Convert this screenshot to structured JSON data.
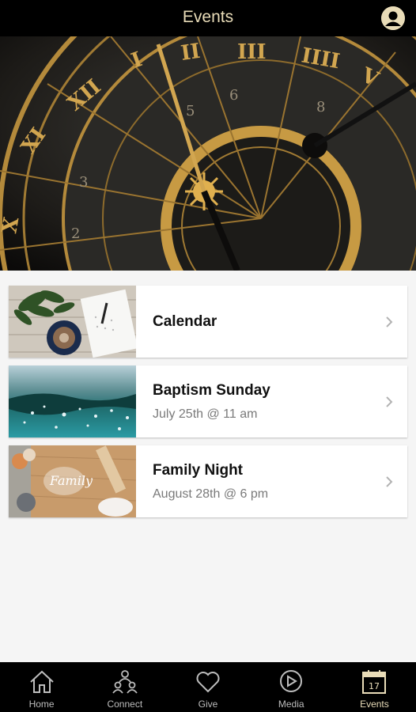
{
  "header": {
    "title": "Events",
    "profile_icon": "profile-icon"
  },
  "events": [
    {
      "name": "Calendar",
      "subtitle": "",
      "thumbnail": "notebook-coffee-photo",
      "chevron_icon": "chevron-right-icon"
    },
    {
      "name": "Baptism Sunday",
      "subtitle": "July 25th @ 11 am",
      "thumbnail": "water-splash-photo",
      "chevron_icon": "chevron-right-icon"
    },
    {
      "name": "Family Night",
      "subtitle": "August 28th @ 6 pm",
      "thumbnail": "baking-family-photo",
      "chevron_icon": "chevron-right-icon"
    }
  ],
  "tabbar": {
    "tabs": [
      {
        "label": "Home",
        "icon": "home-icon",
        "active": false
      },
      {
        "label": "Connect",
        "icon": "connect-icon",
        "active": false
      },
      {
        "label": "Give",
        "icon": "heart-icon",
        "active": false
      },
      {
        "label": "Media",
        "icon": "play-icon",
        "active": false
      },
      {
        "label": "Events",
        "icon": "calendar-icon",
        "active": true
      }
    ],
    "calendar_day": "17"
  },
  "colors": {
    "accent": "#e9dcb8",
    "header_bg": "#000000",
    "page_bg": "#f5f5f5",
    "inactive_tab": "#bdbdbd"
  }
}
